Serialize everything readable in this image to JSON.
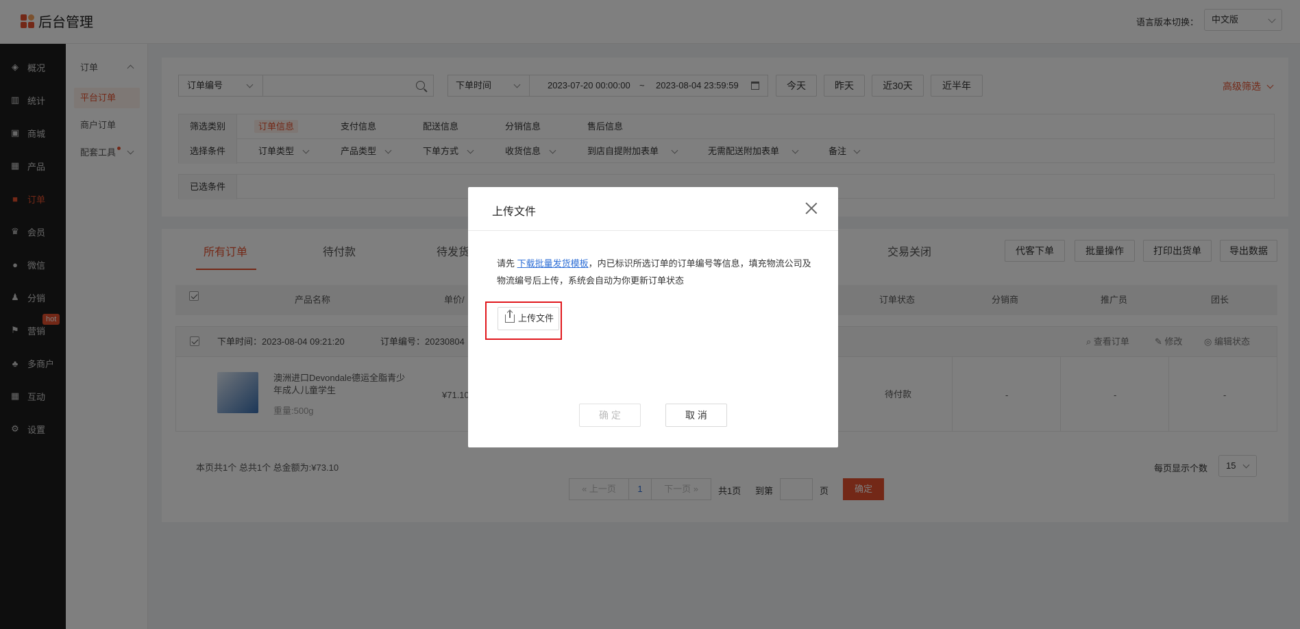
{
  "header": {
    "app_title": "后台管理",
    "lang_label": "语言版本切换：",
    "lang_value": "中文版"
  },
  "sidebar": {
    "items": [
      {
        "label": "概况",
        "icon": "layers-icon"
      },
      {
        "label": "统计",
        "icon": "chart-icon"
      },
      {
        "label": "商城",
        "icon": "shop-icon"
      },
      {
        "label": "产品",
        "icon": "grid-icon"
      },
      {
        "label": "订单",
        "icon": "order-icon"
      },
      {
        "label": "会员",
        "icon": "crown-icon"
      },
      {
        "label": "微信",
        "icon": "wechat-icon"
      },
      {
        "label": "分销",
        "icon": "users-icon"
      },
      {
        "label": "营销",
        "icon": "flag-icon"
      },
      {
        "label": "多商户",
        "icon": "merchant-icon"
      },
      {
        "label": "互动",
        "icon": "apps-icon"
      },
      {
        "label": "设置",
        "icon": "gear-icon"
      }
    ],
    "hot_badge": "hot",
    "accent": "#e6512e"
  },
  "submenu": {
    "group": "订单",
    "items": [
      "平台订单",
      "商户订单",
      "配套工具"
    ]
  },
  "search": {
    "field_select": "订单编号",
    "time_select": "下单时间",
    "date_start": "2023-07-20 00:00:00",
    "date_sep": "~",
    "date_end": "2023-08-04 23:59:59",
    "quick": [
      "今天",
      "昨天",
      "近30天",
      "近半年"
    ],
    "advanced": "高级筛选"
  },
  "filter": {
    "category_label": "筛选类别",
    "categories": [
      "订单信息",
      "支付信息",
      "配送信息",
      "分销信息",
      "售后信息"
    ],
    "condition_label": "选择条件",
    "conditions": [
      "订单类型",
      "产品类型",
      "下单方式",
      "收货信息",
      "到店自提附加表单",
      "无需配送附加表单",
      "备注"
    ],
    "selected_label": "已选条件"
  },
  "tabs": [
    "所有订单",
    "待付款",
    "待发货",
    "交易关闭"
  ],
  "actions": [
    "代客下单",
    "批量操作",
    "打印出货单",
    "导出数据"
  ],
  "table": {
    "headers": [
      "产品名称",
      "单价/",
      "订单状态",
      "分销商",
      "推广员",
      "团长"
    ]
  },
  "order": {
    "time": "下单时间：2023-08-04 09:21:20",
    "number": "订单编号：20230804",
    "view": "查看订单",
    "edit": "修改",
    "edit_status": "编辑状态",
    "product_name": "澳洲进口Devondale德运全脂青少年成人儿童学生",
    "spec": "重量:500g",
    "price": "¥71.10",
    "status": "待付款",
    "distributor": "-",
    "promoter": "-",
    "leader": "-"
  },
  "summary": "本页共1个  总共1个  总金额为:¥73.10",
  "pagination": {
    "prev": "上一页",
    "current": "1",
    "next": "下一页",
    "total_pages": "共1页",
    "goto": "到第",
    "page_unit": "页",
    "confirm": "确定",
    "page_size_label": "每页显示个数",
    "page_size": "15"
  },
  "modal": {
    "title": "上传文件",
    "desc_prefix": "请先 ",
    "desc_link": "下载批量发货模板",
    "desc_suffix": "，内已标识所选订单的订单编号等信息，填充物流公司及物流编号后上传，系统会自动为你更新订单状态",
    "upload_label": "上传文件",
    "confirm_label": "确 定",
    "cancel_label": "取 消"
  }
}
